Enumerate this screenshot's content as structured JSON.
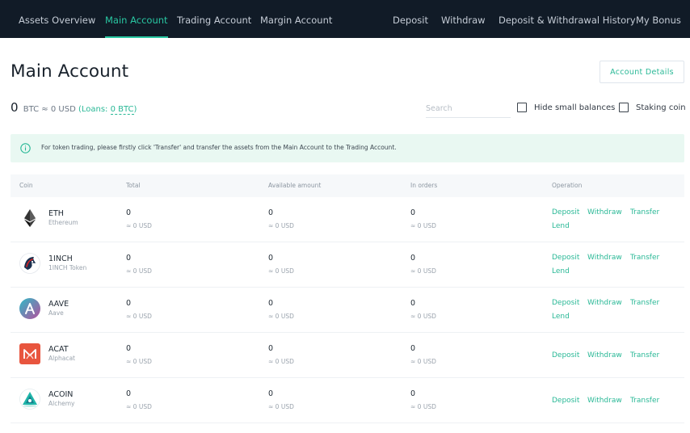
{
  "nav": {
    "left": [
      "Assets Overview",
      "Main Account",
      "Trading Account",
      "Margin Account"
    ],
    "active": "Main Account",
    "right": [
      "Deposit",
      "Withdraw",
      "Deposit & Withdrawal History",
      "My Bonus"
    ]
  },
  "header": {
    "title": "Main Account",
    "details_button": "Account Details"
  },
  "balance": {
    "amount": "0",
    "unit": "BTC",
    "usd": "≈ 0 USD",
    "loans_label": "(Loans:",
    "loans_value": "0 BTC",
    "loans_close": ")"
  },
  "filters": {
    "search_placeholder": "Search",
    "hide_small": "Hide small balances",
    "staking": "Staking coin"
  },
  "notice": {
    "text": "For token trading, please firstly click 'Transfer' and transfer the assets from the Main Account to the Trading Account."
  },
  "table": {
    "columns": [
      "Coin",
      "Total",
      "Available amount",
      "In orders",
      "Operation"
    ],
    "ops": {
      "deposit": "Deposit",
      "withdraw": "Withdraw",
      "transfer": "Transfer",
      "lend": "Lend"
    },
    "rows": [
      {
        "symbol": "ETH",
        "name": "Ethereum",
        "total": "0",
        "total_usd": "≈ 0 USD",
        "available": "0",
        "available_usd": "≈ 0 USD",
        "in_orders": "0",
        "in_orders_usd": "≈ 0 USD",
        "lend": true,
        "icon": "ethereum-icon"
      },
      {
        "symbol": "1INCH",
        "name": "1INCH Token",
        "total": "0",
        "total_usd": "≈ 0 USD",
        "available": "0",
        "available_usd": "≈ 0 USD",
        "in_orders": "0",
        "in_orders_usd": "≈ 0 USD",
        "lend": true,
        "icon": "1inch-icon"
      },
      {
        "symbol": "AAVE",
        "name": "Aave",
        "total": "0",
        "total_usd": "≈ 0 USD",
        "available": "0",
        "available_usd": "≈ 0 USD",
        "in_orders": "0",
        "in_orders_usd": "≈ 0 USD",
        "lend": true,
        "icon": "aave-icon"
      },
      {
        "symbol": "ACAT",
        "name": "Alphacat",
        "total": "0",
        "total_usd": "≈ 0 USD",
        "available": "0",
        "available_usd": "≈ 0 USD",
        "in_orders": "0",
        "in_orders_usd": "≈ 0 USD",
        "lend": false,
        "icon": "alphacat-icon"
      },
      {
        "symbol": "ACOIN",
        "name": "Alchemy",
        "total": "0",
        "total_usd": "≈ 0 USD",
        "available": "0",
        "available_usd": "≈ 0 USD",
        "in_orders": "0",
        "in_orders_usd": "≈ 0 USD",
        "lend": false,
        "icon": "alchemy-icon"
      }
    ]
  },
  "colors": {
    "accent": "#29b896",
    "nav_bg": "#111b27",
    "notice_bg": "#e9f8f2"
  }
}
